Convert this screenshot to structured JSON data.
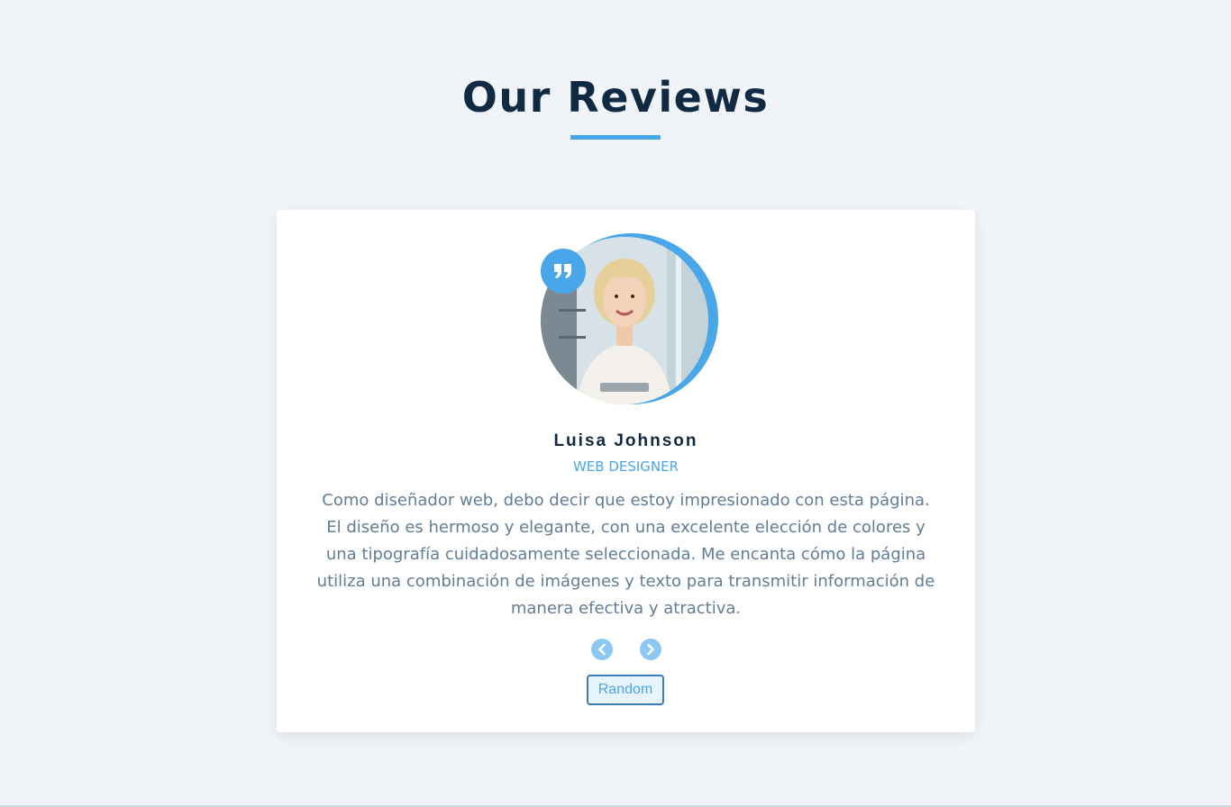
{
  "header": {
    "title": "Our Reviews"
  },
  "review": {
    "name": "Luisa Johnson",
    "job": "WEB DESIGNER",
    "text": "Como diseñador web, debo decir que estoy impresionado con esta página. El diseño es hermoso y elegante, con una excelente elección de colores y una tipografía cuidadosamente seleccionada. Me encanta cómo la página utiliza una combinación de imágenes y texto para transmitir información de manera efectiva y atractiva.",
    "image_icon": "person-photo",
    "quote_icon": "quote-right-icon"
  },
  "controls": {
    "prev_icon": "chevron-left-icon",
    "next_icon": "chevron-right-icon",
    "random_label": "Random"
  },
  "colors": {
    "accent": "#49a6e9",
    "title": "#102a43",
    "text": "#617d98",
    "background": "#f0f4f8",
    "card": "#ffffff"
  }
}
